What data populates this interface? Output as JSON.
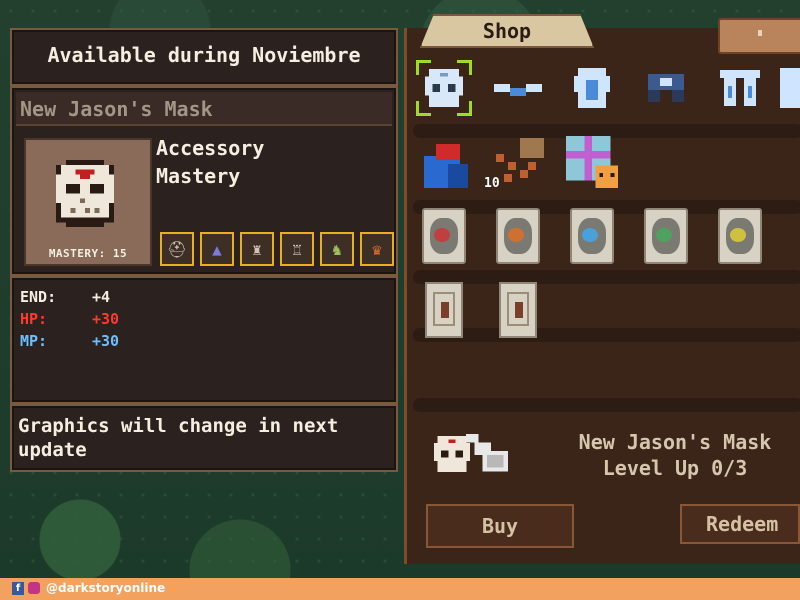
{
  "header": {
    "availability": "Available during Noviembre"
  },
  "item": {
    "name": "New Jason's Mask",
    "type_line1": "Accessory",
    "type_line2": "Mastery",
    "mastery_label": "MASTERY: 15",
    "class_icons": [
      "knight-helmet-icon",
      "wizard-hat-icon",
      "horned-helmet-icon",
      "armor-icon",
      "ranger-helmet-icon",
      "demon-helmet-icon"
    ]
  },
  "stats": [
    {
      "label": "END:",
      "value": "+4",
      "color": "#f4efe0"
    },
    {
      "label": "HP:",
      "value": "+30",
      "color": "#ff3a2a"
    },
    {
      "label": "MP:",
      "value": "+30",
      "color": "#6fbfff"
    }
  ],
  "note": "Graphics will change in next update",
  "shop": {
    "tab_label": "Shop",
    "stack_quantity": "10",
    "preview_name": "New Jason's Mask",
    "preview_level": "Level Up 0/3",
    "buy_label": "Buy",
    "redeem_label": "Redeem"
  },
  "footer": {
    "handle": "@darkstoryonline"
  }
}
